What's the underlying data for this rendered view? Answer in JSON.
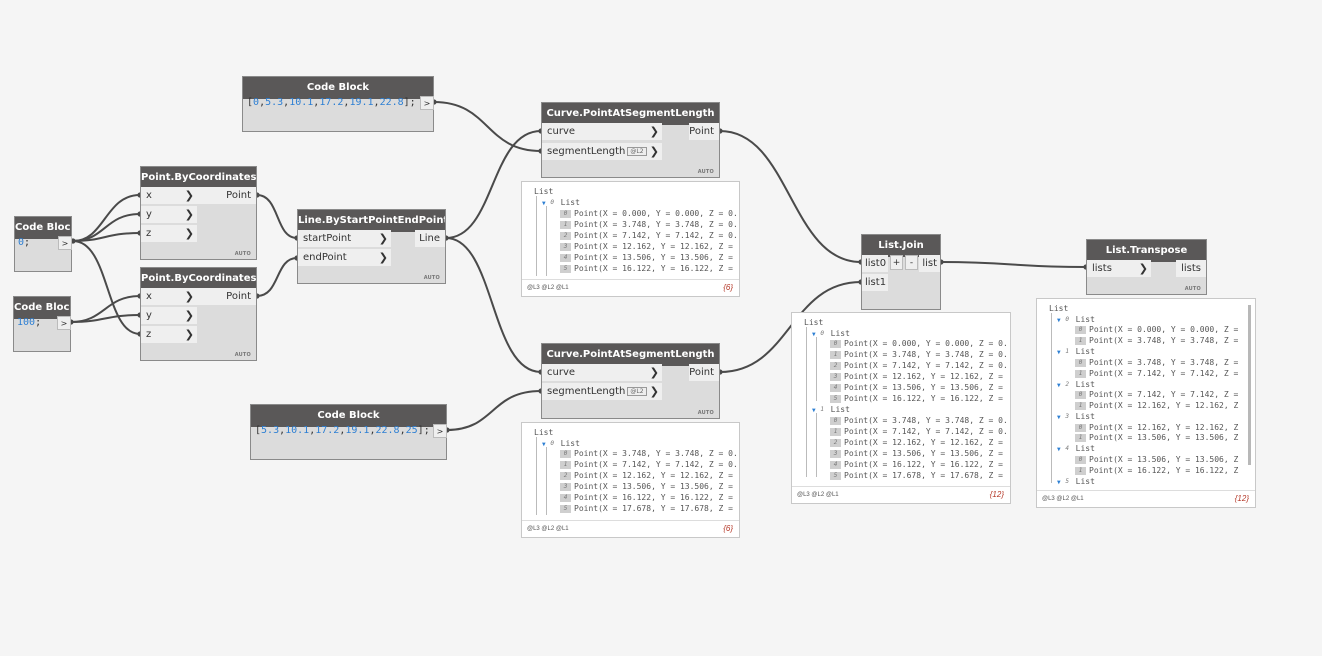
{
  "colors": {
    "header": "#5a5858",
    "canvas": "#f5f5f5",
    "number": "#2d7fd3",
    "wire": "#4a4a4a",
    "count": "#b53a2a"
  },
  "auto_label": "AUTO",
  "output_arrow": ">",
  "input_arrow": "❯",
  "level_label": "@L2",
  "nodes": {
    "cb_top": {
      "title": "Code Block",
      "code": "[0,5.3,10.1,17.2,19.1,22.8];"
    },
    "cb_zero": {
      "title": "Code Block",
      "code": "0;"
    },
    "cb_hundred": {
      "title": "Code Block",
      "code": "100;"
    },
    "cb_bottom": {
      "title": "Code Block",
      "code": "[5.3,10.1,17.2,19.1,22.8,25];"
    },
    "pt1": {
      "title": "Point.ByCoordinates",
      "inputs": [
        "x",
        "y",
        "z"
      ],
      "output": "Point"
    },
    "pt2": {
      "title": "Point.ByCoordinates",
      "inputs": [
        "x",
        "y",
        "z"
      ],
      "output": "Point"
    },
    "line": {
      "title": "Line.ByStartPointEndPoint",
      "inputs": [
        "startPoint",
        "endPoint"
      ],
      "output": "Line"
    },
    "cps1": {
      "title": "Curve.PointAtSegmentLength",
      "inputs": [
        "curve",
        "segmentLength"
      ],
      "output": "Point"
    },
    "cps2": {
      "title": "Curve.PointAtSegmentLength",
      "inputs": [
        "curve",
        "segmentLength"
      ],
      "output": "Point"
    },
    "join": {
      "title": "List.Join",
      "inputs": [
        "list0",
        "list1"
      ],
      "output": "list",
      "plus": "+",
      "minus": "-"
    },
    "transpose": {
      "title": "List.Transpose",
      "inputs": [
        "lists"
      ],
      "output": "lists"
    }
  },
  "previews": {
    "p1": {
      "header": "List",
      "sub": "List",
      "items": [
        "Point(X = 0.000, Y = 0.000, Z = 0.",
        "Point(X = 3.748, Y = 3.748, Z = 0.",
        "Point(X = 7.142, Y = 7.142, Z = 0.",
        "Point(X = 12.162, Y = 12.162, Z =",
        "Point(X = 13.506, Y = 13.506, Z =",
        "Point(X = 16.122, Y = 16.122, Z ="
      ],
      "footer": "@L3 @L2 @L1",
      "count": "{6}"
    },
    "p2": {
      "header": "List",
      "sub": "List",
      "items": [
        "Point(X = 3.748, Y = 3.748, Z = 0.",
        "Point(X = 7.142, Y = 7.142, Z = 0.",
        "Point(X = 12.162, Y = 12.162, Z =",
        "Point(X = 13.506, Y = 13.506, Z =",
        "Point(X = 16.122, Y = 16.122, Z =",
        "Point(X = 17.678, Y = 17.678, Z ="
      ],
      "footer": "@L3 @L2 @L1",
      "count": "{6}"
    },
    "p3": {
      "header": "List",
      "sub0": "List",
      "items0": [
        "Point(X = 0.000, Y = 0.000, Z = 0.",
        "Point(X = 3.748, Y = 3.748, Z = 0.",
        "Point(X = 7.142, Y = 7.142, Z = 0.",
        "Point(X = 12.162, Y = 12.162, Z =",
        "Point(X = 13.506, Y = 13.506, Z =",
        "Point(X = 16.122, Y = 16.122, Z ="
      ],
      "sub1": "List",
      "items1": [
        "Point(X = 3.748, Y = 3.748, Z = 0.",
        "Point(X = 7.142, Y = 7.142, Z = 0.",
        "Point(X = 12.162, Y = 12.162, Z =",
        "Point(X = 13.506, Y = 13.506, Z =",
        "Point(X = 16.122, Y = 16.122, Z =",
        "Point(X = 17.678, Y = 17.678, Z ="
      ],
      "footer": "@L3 @L2 @L1",
      "count": "{12}"
    },
    "p4": {
      "header": "List",
      "groups": [
        {
          "label": "List",
          "items": [
            "Point(X = 0.000, Y = 0.000, Z =",
            "Point(X = 3.748, Y = 3.748, Z ="
          ]
        },
        {
          "label": "List",
          "items": [
            "Point(X = 3.748, Y = 3.748, Z =",
            "Point(X = 7.142, Y = 7.142, Z ="
          ]
        },
        {
          "label": "List",
          "items": [
            "Point(X = 7.142, Y = 7.142, Z =",
            "Point(X = 12.162, Y = 12.162, Z"
          ]
        },
        {
          "label": "List",
          "items": [
            "Point(X = 12.162, Y = 12.162, Z",
            "Point(X = 13.506, Y = 13.506, Z"
          ]
        },
        {
          "label": "List",
          "items": [
            "Point(X = 13.506, Y = 13.506, Z",
            "Point(X = 16.122, Y = 16.122, Z"
          ]
        },
        {
          "label": "List",
          "items": []
        }
      ],
      "footer": "@L3 @L2 @L1",
      "count": "{12}"
    }
  }
}
